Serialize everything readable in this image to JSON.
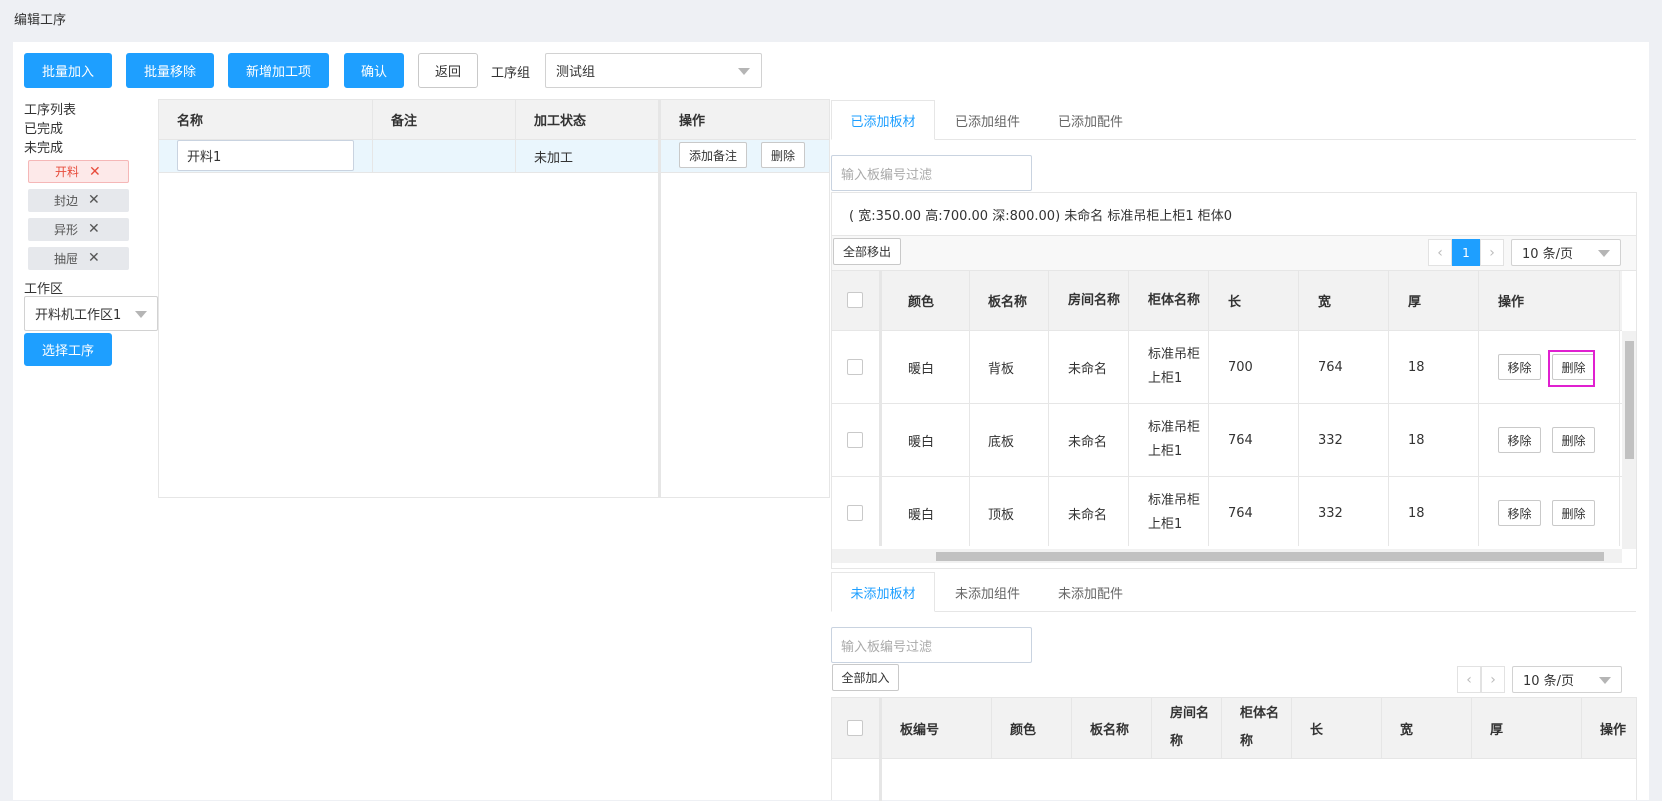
{
  "page": {
    "title": "编辑工序"
  },
  "toolbar": {
    "batch_add": "批量加入",
    "batch_remove": "批量移除",
    "new_item": "新增加工项",
    "confirm": "确认",
    "back": "返回",
    "group_label": "工序组",
    "group_value": "测试组"
  },
  "sidebar": {
    "list_title": "工序列表",
    "done": "已完成",
    "undone": "未完成",
    "tags": [
      {
        "label": "开料",
        "active": true
      },
      {
        "label": "封边"
      },
      {
        "label": "异形"
      },
      {
        "label": "抽屉"
      }
    ],
    "workzone_label": "工作区",
    "workzone_value": "开料机工作区1",
    "select_button": "选择工序"
  },
  "process_table": {
    "headers": [
      "名称",
      "备注",
      "加工状态",
      "操作"
    ],
    "rows": [
      {
        "name": "开料1",
        "note": "",
        "status": "未加工",
        "add_note": "添加备注",
        "delete": "删除"
      }
    ]
  },
  "added_panel": {
    "tabs": [
      "已添加板材",
      "已添加组件",
      "已添加配件"
    ],
    "filter_placeholder": "输入板编号过滤",
    "group_info": "( 宽:350.00 高:700.00 深:800.00) 未命名 标准吊柜上柜1 柜体0",
    "remove_all": "全部移出",
    "page": "1",
    "page_size": "10 条/页",
    "headers": [
      "颜色",
      "板名称",
      "房间名称",
      "柜体名称",
      "长",
      "宽",
      "厚",
      "操作"
    ],
    "rows": [
      {
        "color": "暖白",
        "name": "背板",
        "room": "未命名",
        "cabinet": "标准吊柜上柜1",
        "length": "700",
        "width": "764",
        "thick": "18",
        "remove": "移除",
        "delete": "删除"
      },
      {
        "color": "暖白",
        "name": "底板",
        "room": "未命名",
        "cabinet": "标准吊柜上柜1",
        "length": "764",
        "width": "332",
        "thick": "18",
        "remove": "移除",
        "delete": "删除"
      },
      {
        "color": "暖白",
        "name": "顶板",
        "room": "未命名",
        "cabinet": "标准吊柜上柜1",
        "length": "764",
        "width": "332",
        "thick": "18",
        "remove": "移除",
        "delete": "删除"
      }
    ]
  },
  "not_added_panel": {
    "tabs": [
      "未添加板材",
      "未添加组件",
      "未添加配件"
    ],
    "filter_placeholder": "输入板编号过滤",
    "add_all": "全部加入",
    "page_size": "10 条/页",
    "headers": [
      "板编号",
      "颜色",
      "板名称",
      "房间名称",
      "柜体名称",
      "长",
      "宽",
      "厚",
      "操作"
    ]
  },
  "colors": {
    "primary": "#1e9fff",
    "highlight": "#e020d0",
    "tag_active": "#e74c3c"
  }
}
